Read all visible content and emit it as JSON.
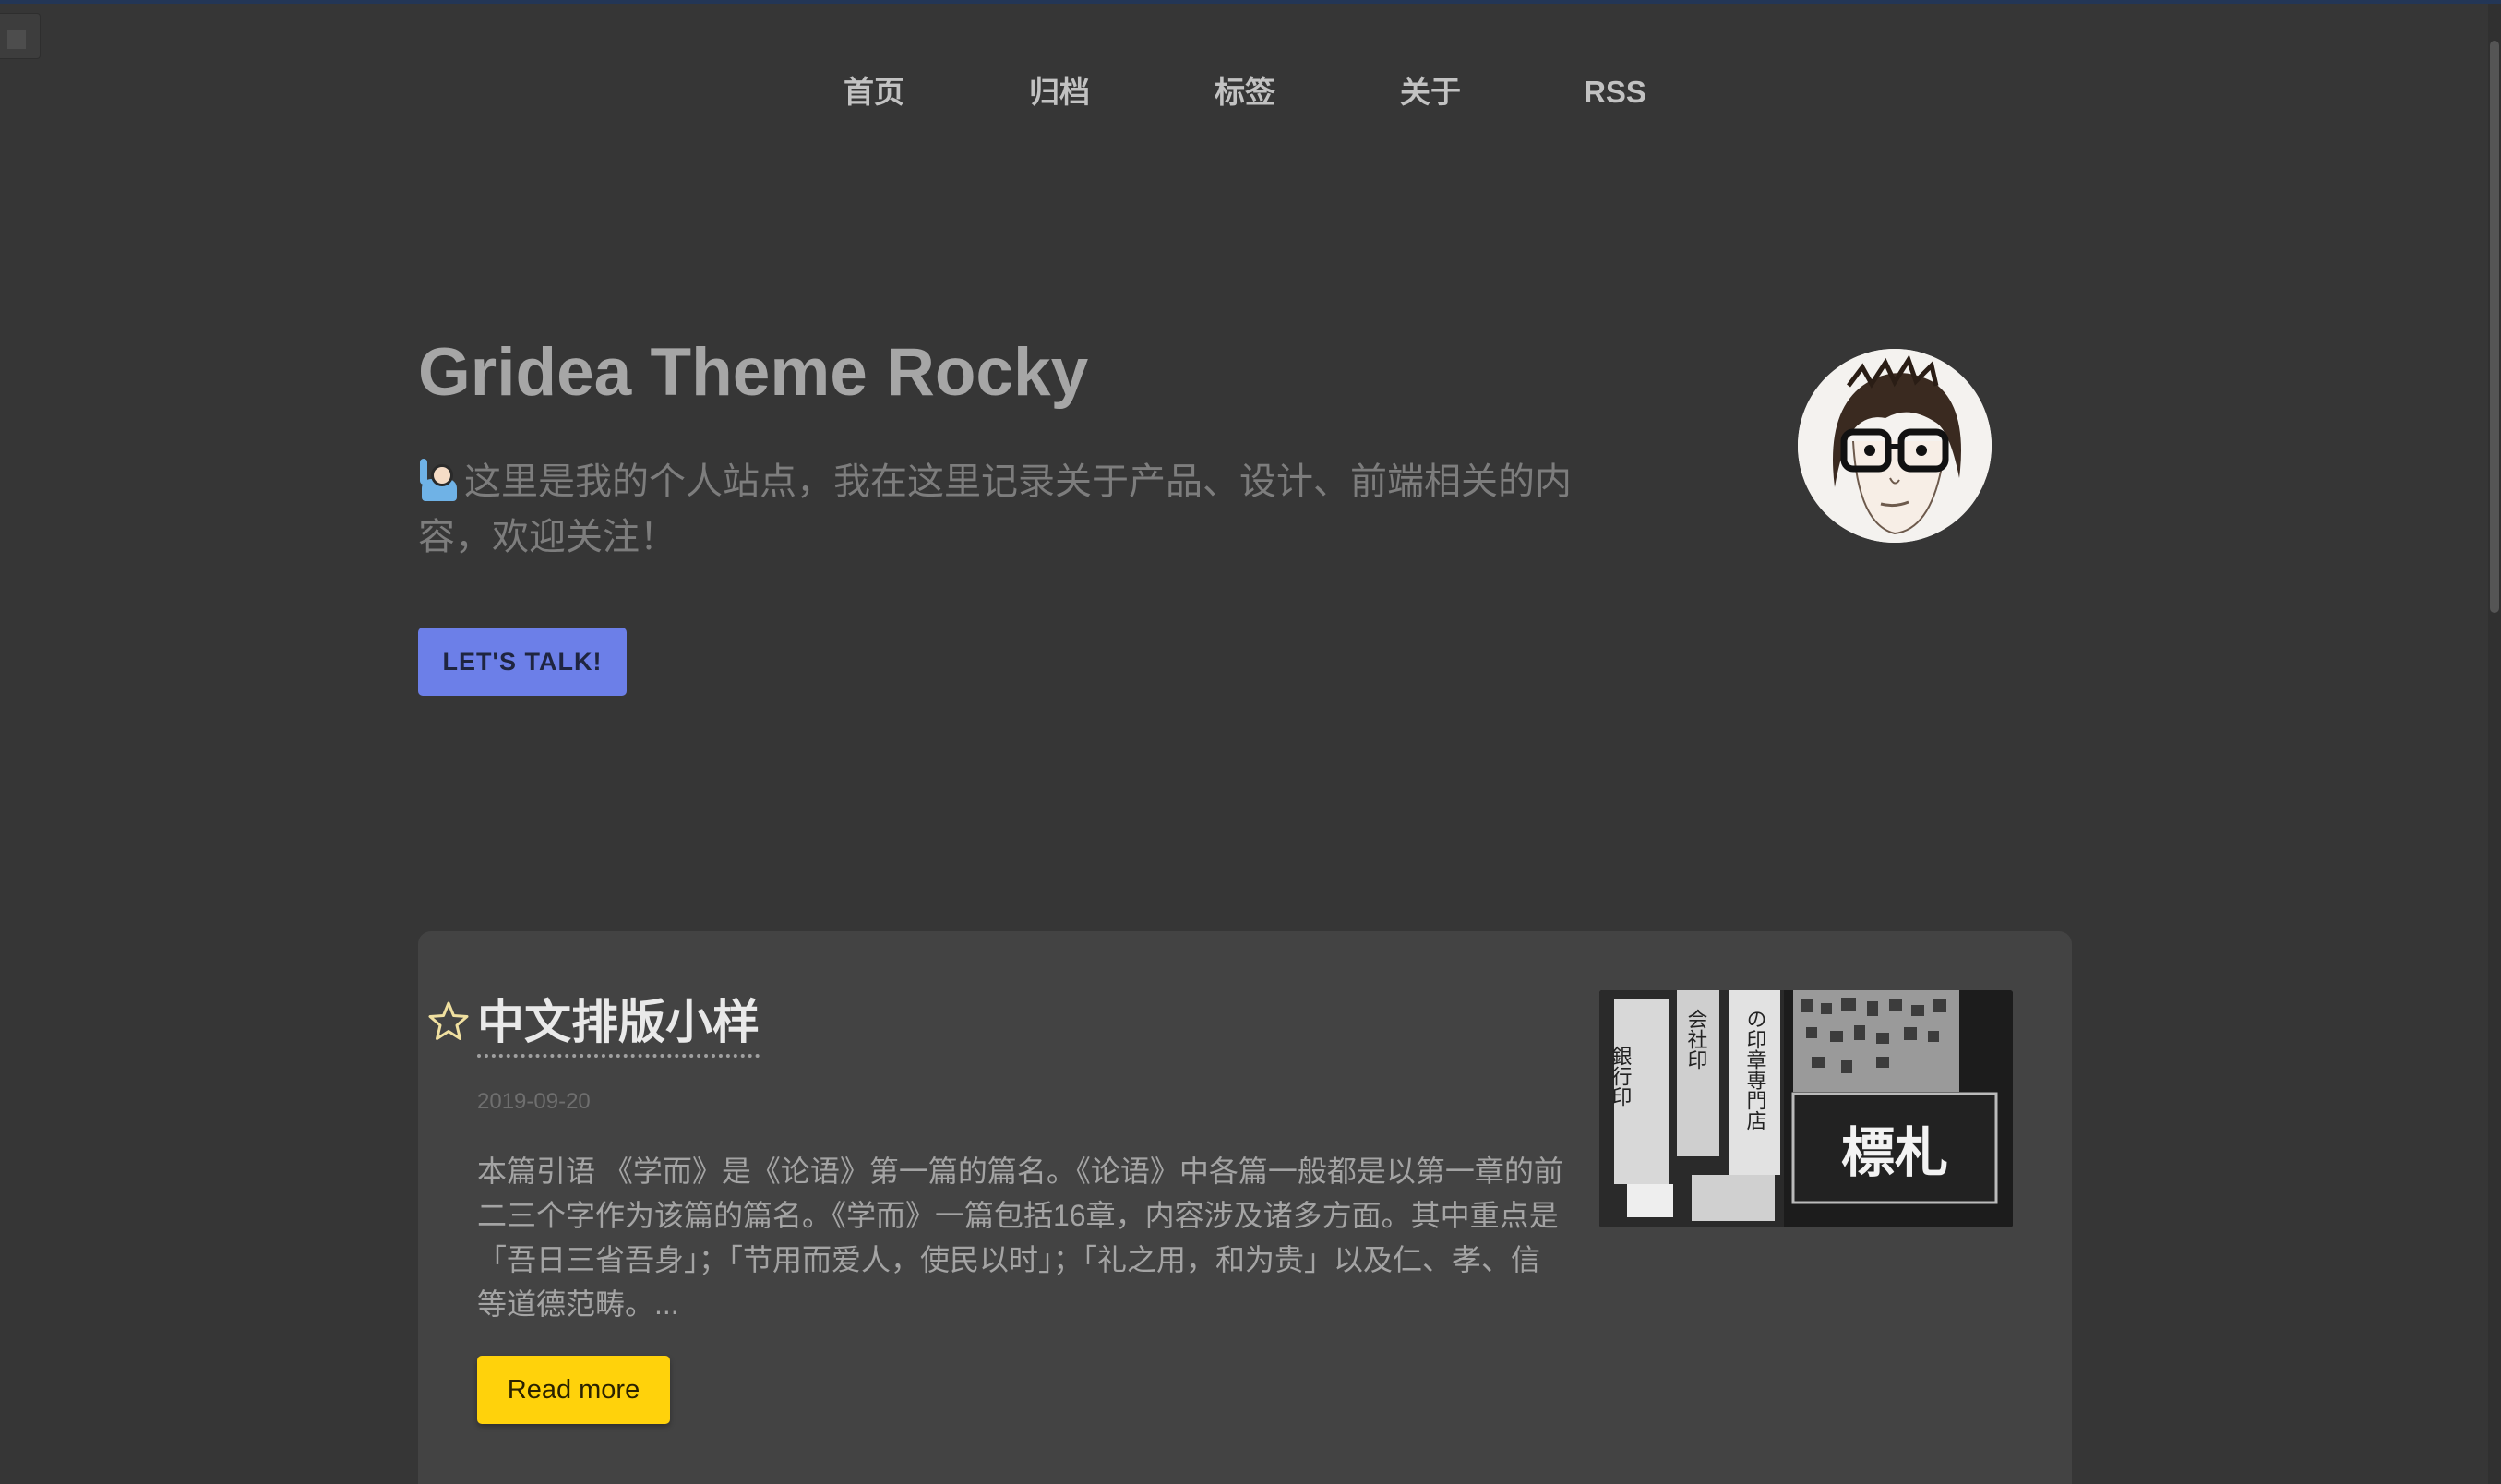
{
  "nav": {
    "items": [
      {
        "label": "首页"
      },
      {
        "label": "归档"
      },
      {
        "label": "标签"
      },
      {
        "label": "关于"
      },
      {
        "label": "RSS"
      }
    ]
  },
  "hero": {
    "title": "Gridea Theme Rocky",
    "description": "这里是我的个人站点，我在这里记录关于产品、设计、前端相关的内容，欢迎关注！",
    "cta_label": "LET'S TALK!",
    "emoji_icon": "person-raising-hand-icon",
    "avatar_icon": "avatar-cartoon-glasses"
  },
  "posts": [
    {
      "title": "中文排版小样",
      "date": "2019-09-20",
      "excerpt": "本篇引语 《学而》是《论语》第一篇的篇名。《论语》中各篇一般都是以第一章的前二三个字作为该篇的篇名。《学而》一篇包括16章，内容涉及诸多方面。其中重点是「吾日三省吾身」；「节用而爱人，使民以时」；「礼之用，和为贵」以及仁、孝、信等道德范畴。...",
      "read_more_label": "Read more",
      "thumbnail_text": "標札",
      "thumbnail_signs": [
        "銀行印",
        "会社印",
        "の印章専門店"
      ],
      "featured_icon": "star-outline-icon"
    }
  ],
  "colors": {
    "background": "#363636",
    "card": "#434343",
    "cta": "#6c7fe8",
    "read_more": "#ffd20b"
  }
}
